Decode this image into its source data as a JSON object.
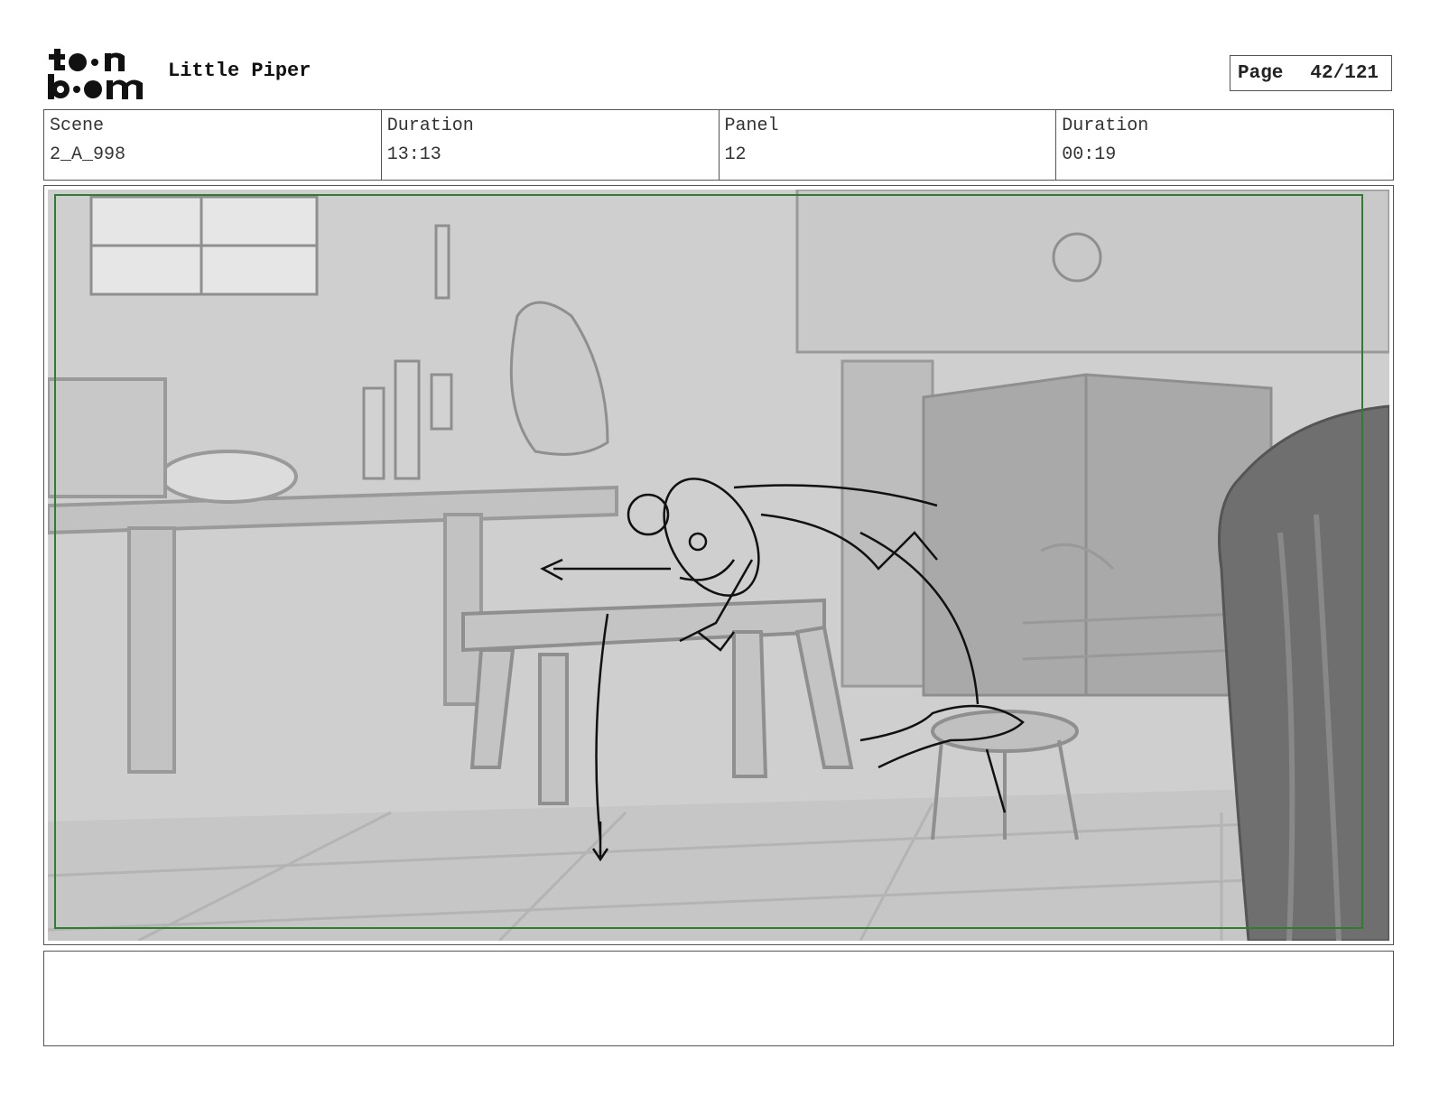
{
  "header": {
    "brand_logo": "toonboom-logo",
    "project_title": "Little Piper",
    "page_label": "Page",
    "page_number": "42/121"
  },
  "info": {
    "scene_label": "Scene",
    "scene_value": "2_A_998",
    "scene_duration_label": "Duration",
    "scene_duration_value": "13:13",
    "panel_label": "Panel",
    "panel_value": "12",
    "panel_duration_label": "Duration",
    "panel_duration_value": "00:19"
  },
  "panel": {
    "frame_color": "#2e7d32",
    "background_color": "#cfcfcf"
  },
  "notes": {
    "text": ""
  }
}
